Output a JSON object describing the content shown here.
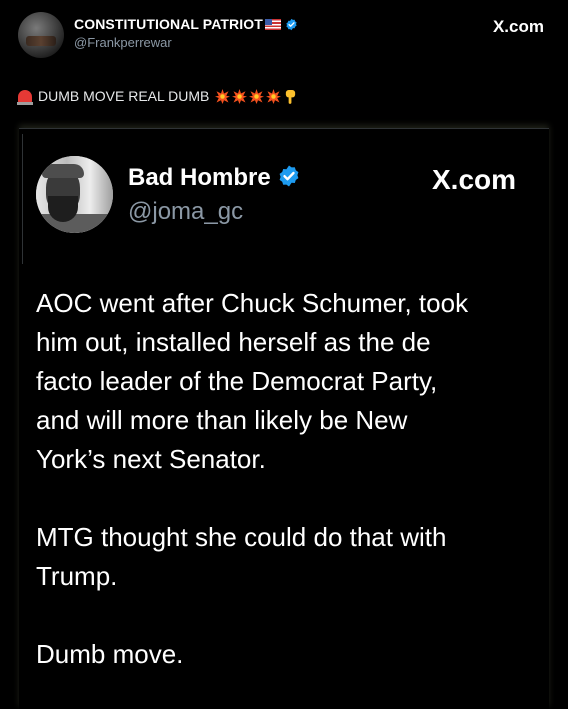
{
  "outer": {
    "name": "CONSTITUTIONAL PATRIOT",
    "handle": "@Frankperrewar",
    "site": "X.com",
    "caption": "DUMB MOVE REAL DUMB"
  },
  "quoted": {
    "name": "Bad Hombre",
    "handle": "@joma_gc",
    "site": "X.com",
    "paragraphs": {
      "p1": {
        "l1": "AOC went after Chuck Schumer, took",
        "l2": "him out, installed herself as the de",
        "l3": "facto leader of the Democrat Party,",
        "l4": "and will more than likely be New",
        "l5": "York’s next Senator."
      },
      "p2": {
        "l1": "MTG thought she could do that with",
        "l2": "Trump."
      },
      "p3": {
        "l1": "Dumb move."
      }
    }
  },
  "icons": {
    "verified": "verified-badge-icon",
    "flag": "us-flag-icon",
    "siren": "siren-icon",
    "spark": "collision-spark-icon",
    "hand": "pointing-down-hand-icon"
  },
  "colors": {
    "background": "#000000",
    "text": "#ffffff",
    "secondary": "#8b98a5",
    "verified": "#1d9bf0"
  }
}
